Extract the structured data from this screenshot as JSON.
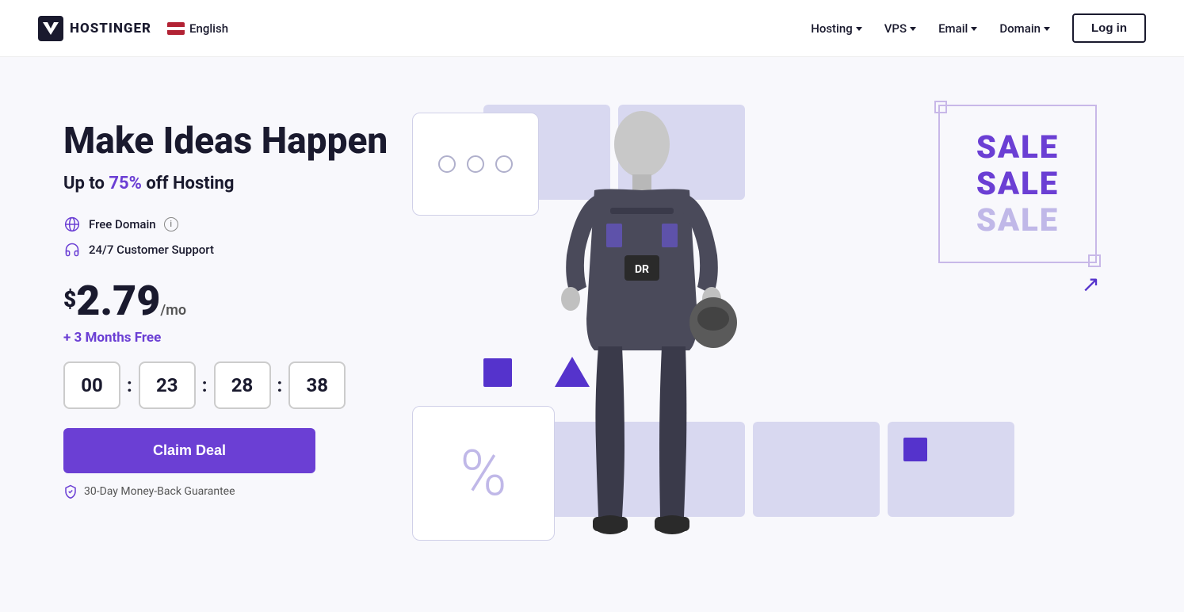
{
  "nav": {
    "logo_text": "HOSTINGER",
    "lang": "English",
    "hosting": "Hosting",
    "vps": "VPS",
    "email": "Email",
    "domain": "Domain",
    "login": "Log in"
  },
  "hero": {
    "headline": "Make Ideas Happen",
    "subheadline_prefix": "Up to ",
    "subheadline_highlight": "75%",
    "subheadline_suffix": " off Hosting",
    "feature_domain": "Free Domain",
    "feature_support": "24/7 Customer Support",
    "price_dollar": "$",
    "price_main": "2.79",
    "price_suffix": "/mo",
    "free_months": "+ 3 Months Free",
    "countdown": {
      "hours": "00",
      "minutes": "23",
      "seconds": "28",
      "frames": "38"
    },
    "claim_btn": "Claim Deal",
    "guarantee": "30-Day Money-Back Guarantee"
  },
  "sale": {
    "line1": "SALE",
    "line2": "SALE",
    "line3": "SALE"
  },
  "colors": {
    "purple": "#6b3fd4",
    "dark": "#1a1a2e",
    "light_blue": "#d8d8f0"
  }
}
